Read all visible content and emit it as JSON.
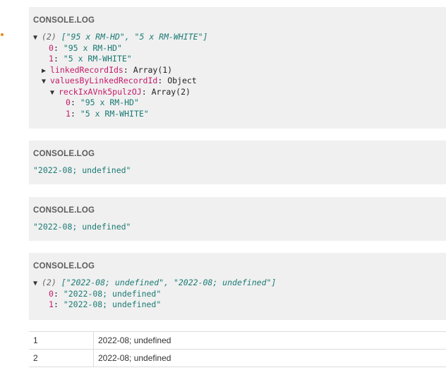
{
  "panels": [
    {
      "label": "CONSOLE.LOG",
      "lines": [
        {
          "indent": 0,
          "tri": "▼",
          "italic": "(2) ",
          "str": "[\"95 x RM-HD\", \"5 x RM-WHITE\"]"
        },
        {
          "indent": 1,
          "key": "0",
          "sep": ": ",
          "str": "\"95 x RM-HD\""
        },
        {
          "indent": 1,
          "key": "1",
          "sep": ": ",
          "str": "\"5 x RM-WHITE\""
        },
        {
          "indent": 1,
          "tri": "▶",
          "key": "linkedRecordIds",
          "sep": ": ",
          "plain": "Array(1)"
        },
        {
          "indent": 1,
          "tri": "▼",
          "key": "valuesByLinkedRecordId",
          "sep": ": ",
          "plain": "Object"
        },
        {
          "indent": 2,
          "tri": "▼",
          "key": "reckIxAVnk5pulzOJ",
          "sep": ": ",
          "plain": "Array(2)"
        },
        {
          "indent": 3,
          "key": "0",
          "sep": ": ",
          "str": "\"95 x RM-HD\""
        },
        {
          "indent": 3,
          "key": "1",
          "sep": ": ",
          "str": "\"5 x RM-WHITE\""
        }
      ]
    },
    {
      "label": "CONSOLE.LOG",
      "lines": [
        {
          "indent": 0,
          "str": "\"2022-08; undefined\""
        }
      ]
    },
    {
      "label": "CONSOLE.LOG",
      "lines": [
        {
          "indent": 0,
          "str": "\"2022-08; undefined\""
        }
      ]
    },
    {
      "label": "CONSOLE.LOG",
      "lines": [
        {
          "indent": 0,
          "tri": "▼",
          "italic": "(2) ",
          "str": "[\"2022-08; undefined\", \"2022-08; undefined\"]"
        },
        {
          "indent": 1,
          "key": "0",
          "sep": ": ",
          "str": "\"2022-08; undefined\""
        },
        {
          "indent": 1,
          "key": "1",
          "sep": ": ",
          "str": "\"2022-08; undefined\""
        }
      ]
    }
  ],
  "table": {
    "rows": [
      {
        "index": "1",
        "value": "2022-08; undefined"
      },
      {
        "index": "2",
        "value": "2022-08; undefined"
      }
    ]
  }
}
